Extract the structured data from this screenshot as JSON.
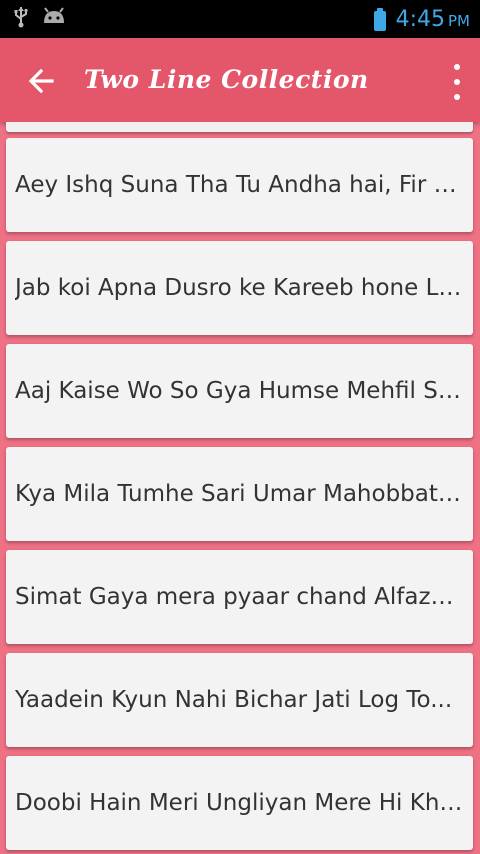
{
  "status_bar": {
    "icons": [
      "usb-icon",
      "android-debug-icon"
    ],
    "battery_icon": "battery-icon",
    "time": "4:45",
    "ampm": "PM",
    "accent": "#3fa9e8"
  },
  "app_bar": {
    "title": "Two Line Collection",
    "back_icon": "arrow-back-icon",
    "menu_icon": "more-vert-icon",
    "color": "#e4566a"
  },
  "list": {
    "items": [
      {
        "text": "Aey Ishq Suna Tha Tu Andha hai, Fir Kaise..."
      },
      {
        "text": "Jab koi Apna Dusro ke Kareeb hone Lage..."
      },
      {
        "text": "Aaj Kaise Wo So Gya Humse Mehfil Se..."
      },
      {
        "text": "Kya Mila Tumhe Sari Umar Mahobbat Karke..."
      },
      {
        "text": "Simat Gaya mera pyaar chand Alfazon Mein..."
      },
      {
        "text": "Yaadein Kyun Nahi Bichar Jati Log To..."
      },
      {
        "text": "Doobi Hain Meri Ungliyan Mere Hi Khoon..."
      }
    ]
  },
  "colors": {
    "background": "#ee7184",
    "card": "#f3f3f3",
    "text": "#333333"
  }
}
